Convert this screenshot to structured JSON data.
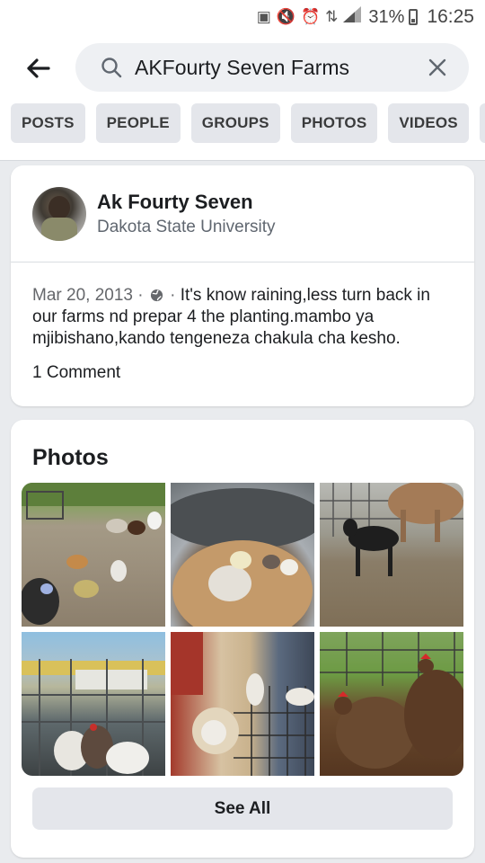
{
  "status_bar": {
    "battery_percent": "31%",
    "time": "16:25",
    "icons": [
      "notification-icon",
      "mute-icon",
      "alarm-icon",
      "data-icon",
      "signal-icon",
      "battery-icon"
    ]
  },
  "search": {
    "value": "AKFourty Seven Farms"
  },
  "filters": [
    "POSTS",
    "PEOPLE",
    "GROUPS",
    "PHOTOS",
    "VIDEOS",
    "P"
  ],
  "profile": {
    "name": "Ak Fourty Seven",
    "subtitle": "Dakota State University"
  },
  "post": {
    "date": "Mar 20, 2013",
    "separator": "·",
    "privacy_icon": "globe-icon",
    "text": "It's know raining,less turn back in our farms nd prepar 4 the planting.mambo ya mjibishano,kando tengeneza chakula cha kesho.",
    "comments": "1 Comment"
  },
  "photos_section": {
    "title": "Photos",
    "see_all_label": "See All"
  },
  "colors": {
    "page_bg": "#e9ebee",
    "card_bg": "#ffffff",
    "chip_bg": "#e4e6eb",
    "text_primary": "#1c1e21",
    "text_secondary": "#606770"
  }
}
